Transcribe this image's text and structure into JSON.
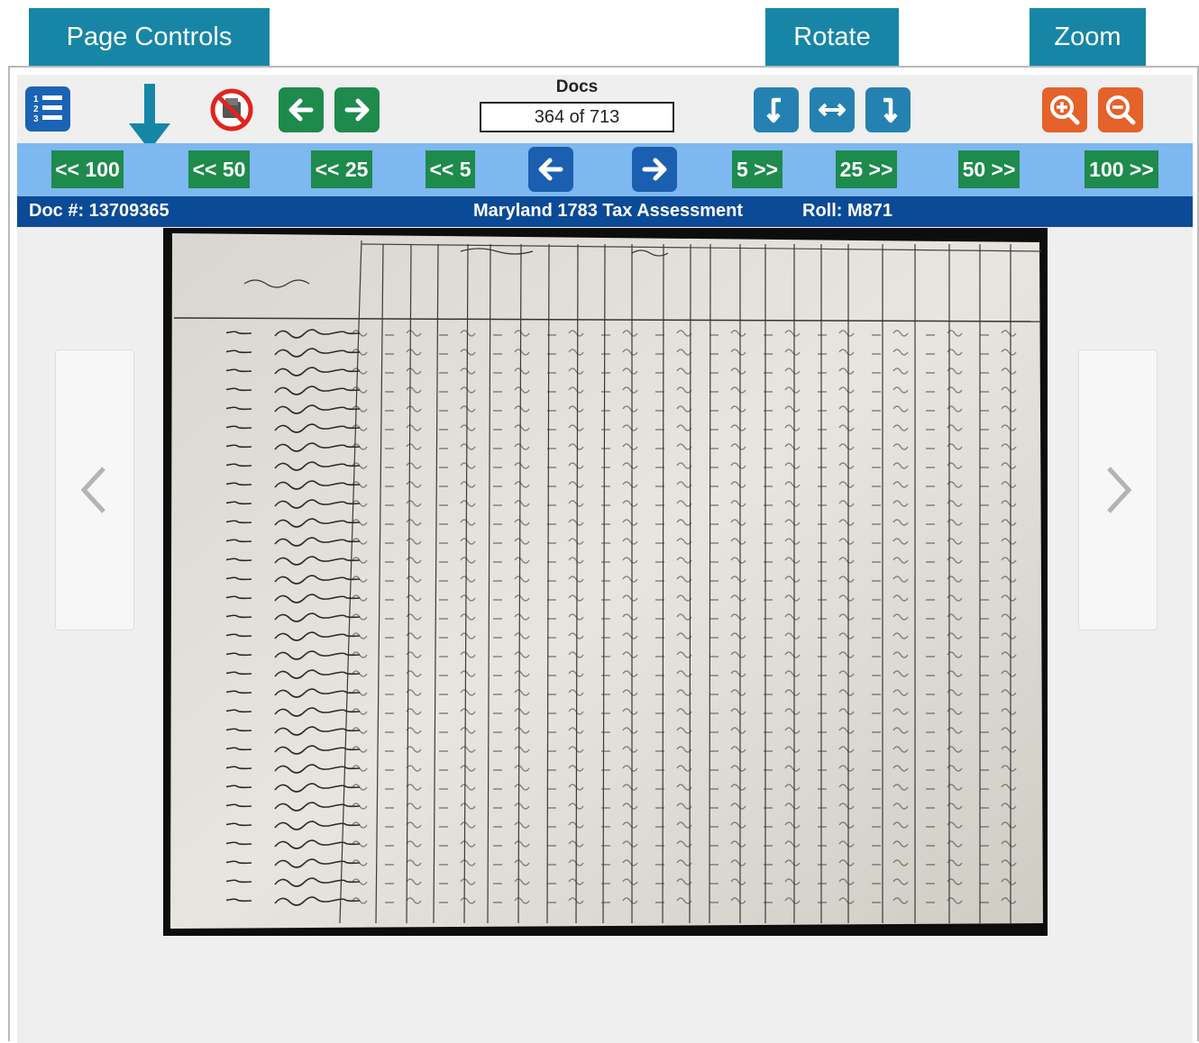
{
  "callouts": {
    "page_controls": "Page Controls",
    "rotate": "Rotate",
    "zoom": "Zoom"
  },
  "toolbar": {
    "docs_label": "Docs",
    "counter": "364 of 713"
  },
  "nav": {
    "back_100": "<< 100",
    "back_50": "<< 50",
    "back_25": "<< 25",
    "back_5": "<< 5",
    "fwd_5": "5 >>",
    "fwd_25": "25 >>",
    "fwd_50": "50 >>",
    "fwd_100": "100 >>"
  },
  "info": {
    "doc_number": "Doc #: 13709365",
    "title": "Maryland 1783 Tax Assessment",
    "roll": "Roll: M871"
  },
  "colors": {
    "callout": "#1786a6",
    "nav_green": "#1e8a4c",
    "rotate_blue": "#2481b2",
    "zoom_orange": "#e5622a",
    "navbar": "#7db8f0",
    "infobar": "#0b4a96"
  }
}
